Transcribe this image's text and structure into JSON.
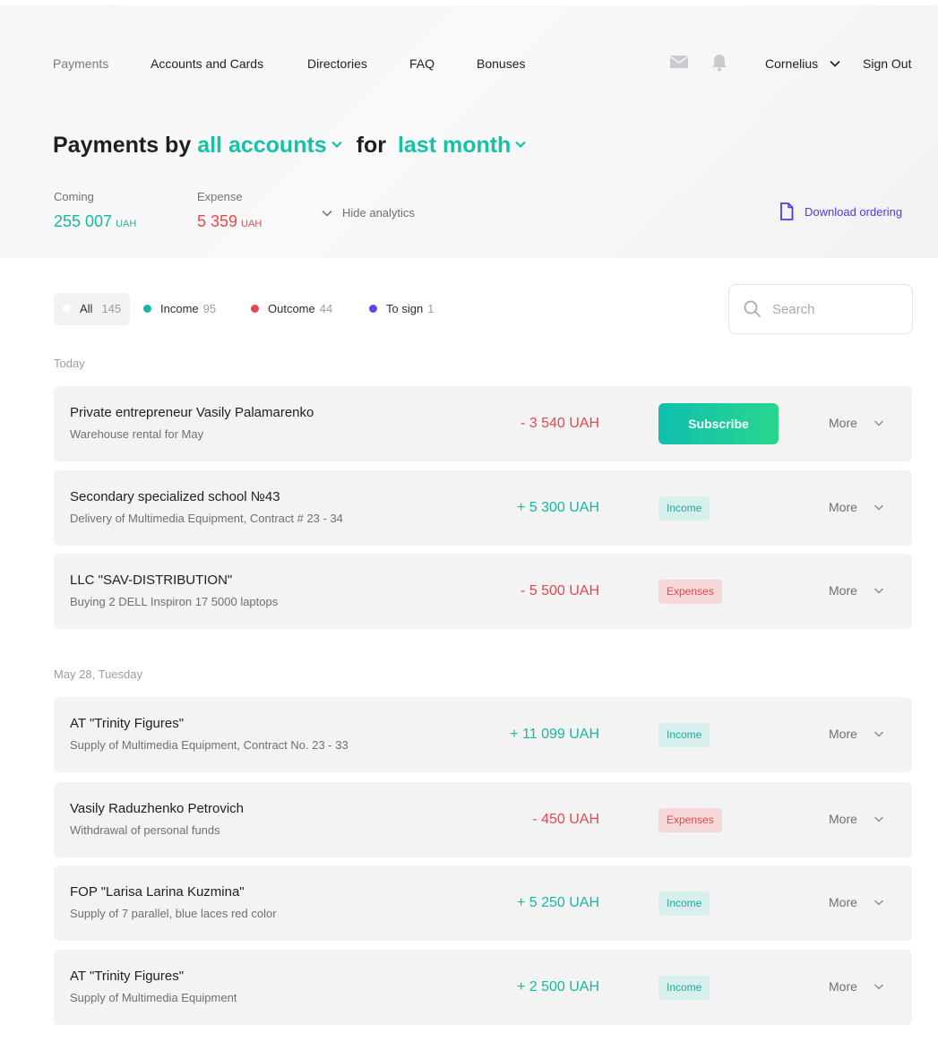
{
  "nav": {
    "items": [
      {
        "label": "Payments"
      },
      {
        "label": "Accounts and Cards"
      },
      {
        "label": "Directories"
      },
      {
        "label": "FAQ"
      },
      {
        "label": "Bonuses"
      }
    ],
    "user": "Cornelius",
    "signout": "Sign Out",
    "icons": {
      "mail": "mail-icon",
      "bell": "bell-icon"
    }
  },
  "headline": {
    "prefix": "Payments by",
    "accounts": "all accounts",
    "middle": "for",
    "period": "last month"
  },
  "stats": {
    "coming_label": "Coming",
    "coming_value": "255 007",
    "coming_unit": "UAH",
    "expense_label": "Expense",
    "expense_value": "5 359",
    "expense_unit": "UAH",
    "hide_analytics": "Hide analytics",
    "download": "Download ordering"
  },
  "filters": [
    {
      "label": "All",
      "count": "145",
      "color": "#ffffff"
    },
    {
      "label": "Income",
      "count": "95",
      "color": "#16b8a0"
    },
    {
      "label": "Outcome",
      "count": "44",
      "color": "#e5484d"
    },
    {
      "label": "To sign",
      "count": "1",
      "color": "#5b47e8"
    }
  ],
  "search": {
    "placeholder": "Search"
  },
  "colors": {
    "accent": "#16c1a5",
    "income": "#16b8a0",
    "expense": "#e5484d",
    "link": "#4a3de0"
  },
  "groups": [
    {
      "label": "Today",
      "payments": [
        {
          "title": "Private entrepreneur Vasily Palamarenko",
          "desc": "Warehouse rental for May",
          "amount": "- 3 540 UAH",
          "type": "out",
          "action": "Subscribe",
          "more": "More"
        },
        {
          "title": "Secondary specialized school №43",
          "desc": "Delivery of Multimedia Equipment, Contract # 23 - 34",
          "amount": "+ 5 300 UAH",
          "type": "in",
          "badge": "Income",
          "more": "More"
        },
        {
          "title": "LLC \"SAV-DISTRIBUTION\"",
          "desc": "Buying 2 DELL Inspiron 17 5000 laptops",
          "amount": "- 5 500 UAH",
          "type": "out",
          "badge": "Expenses",
          "more": "More"
        }
      ]
    },
    {
      "label": "May 28, Tuesday",
      "payments": [
        {
          "title": "AT \"Trinity Figures\"",
          "desc": "Supply of Multimedia Equipment, Contract No. 23 - 33",
          "amount": "+ 11 099 UAH",
          "type": "in",
          "badge": "Income",
          "more": "More"
        },
        {
          "title": "Vasily Raduzhenko Petrovich",
          "desc": "Withdrawal of personal funds",
          "amount": "- 450 UAH",
          "type": "out",
          "badge": "Expenses",
          "more": "More"
        },
        {
          "title": "FOP \"Larisa Larina Kuzmina\"",
          "desc": "Supply of 7 parallel, blue laces red color",
          "amount": "+ 5 250 UAH",
          "type": "in",
          "badge": "Income",
          "more": "More"
        },
        {
          "title": "AT \"Trinity Figures\"",
          "desc": "Supply of Multimedia Equipment",
          "amount": "+ 2 500 UAH",
          "type": "in",
          "badge": "Income",
          "more": "More"
        }
      ]
    }
  ]
}
